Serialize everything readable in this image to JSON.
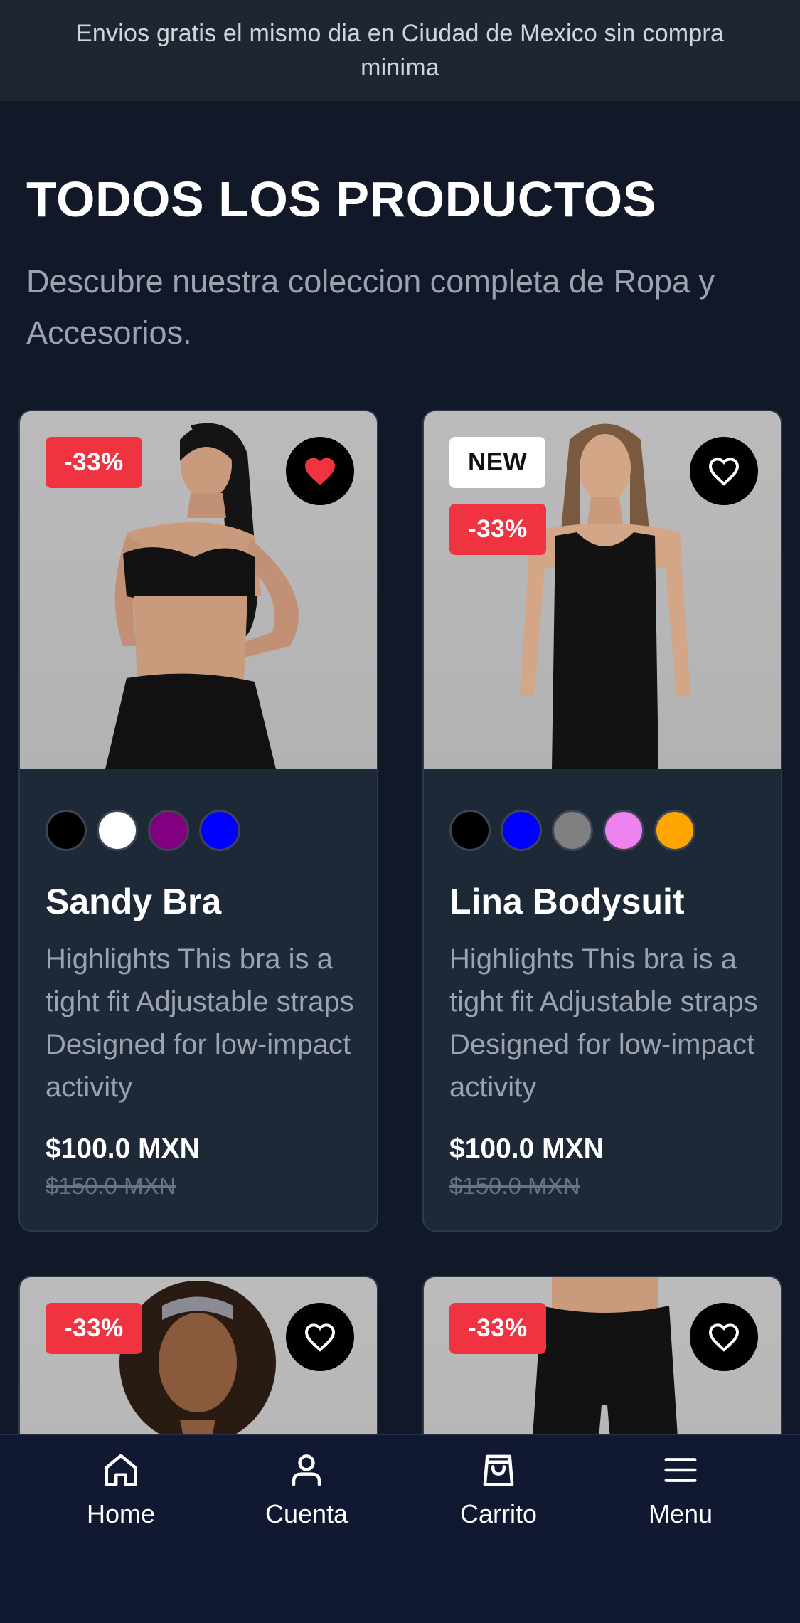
{
  "announcement": "Envios gratis el mismo dia en Ciudad de Mexico sin compra minima",
  "heading": "TODOS LOS PRODUCTOS",
  "subheading": "Descubre nuestra coleccion completa de Ropa y Accesorios.",
  "products": [
    {
      "badges": [
        "-33%"
      ],
      "favorited": true,
      "colors": [
        "#000000",
        "#ffffff",
        "#800080",
        "#0000ff"
      ],
      "name": "Sandy Bra",
      "description": "Highlights This bra is a tight fit Adjustable straps Designed for low-impact activity",
      "price": "$100.0 MXN",
      "old_price": "$150.0 MXN"
    },
    {
      "badges": [
        "NEW",
        "-33%"
      ],
      "favorited": false,
      "colors": [
        "#000000",
        "#0000ff",
        "#808080",
        "#ee82ee",
        "#ffa500"
      ],
      "name": "Lina Bodysuit",
      "description": "Highlights This bra is a tight fit Adjustable straps Designed for low-impact activity",
      "price": "$100.0 MXN",
      "old_price": "$150.0 MXN"
    },
    {
      "badges": [
        "-33%"
      ],
      "favorited": false
    },
    {
      "badges": [
        "-33%"
      ],
      "favorited": false
    }
  ],
  "bottom_nav": [
    {
      "label": "Home",
      "icon": "home-icon"
    },
    {
      "label": "Cuenta",
      "icon": "user-icon"
    },
    {
      "label": "Carrito",
      "icon": "shopping-bag-icon"
    },
    {
      "label": "Menu",
      "icon": "menu-icon"
    }
  ],
  "colors": {
    "background": "#111827",
    "card": "#1e2938",
    "sale_badge": "#ef3340",
    "favorite_active": "#ef3340"
  }
}
